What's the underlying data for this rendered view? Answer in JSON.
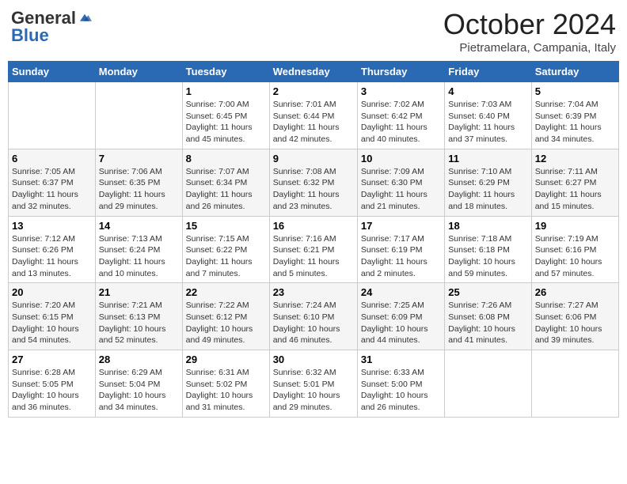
{
  "header": {
    "logo_general": "General",
    "logo_blue": "Blue",
    "month_title": "October 2024",
    "location": "Pietramelara, Campania, Italy"
  },
  "weekdays": [
    "Sunday",
    "Monday",
    "Tuesday",
    "Wednesday",
    "Thursday",
    "Friday",
    "Saturday"
  ],
  "weeks": [
    [
      {
        "day": "",
        "info": ""
      },
      {
        "day": "",
        "info": ""
      },
      {
        "day": "1",
        "info": "Sunrise: 7:00 AM\nSunset: 6:45 PM\nDaylight: 11 hours and 45 minutes."
      },
      {
        "day": "2",
        "info": "Sunrise: 7:01 AM\nSunset: 6:44 PM\nDaylight: 11 hours and 42 minutes."
      },
      {
        "day": "3",
        "info": "Sunrise: 7:02 AM\nSunset: 6:42 PM\nDaylight: 11 hours and 40 minutes."
      },
      {
        "day": "4",
        "info": "Sunrise: 7:03 AM\nSunset: 6:40 PM\nDaylight: 11 hours and 37 minutes."
      },
      {
        "day": "5",
        "info": "Sunrise: 7:04 AM\nSunset: 6:39 PM\nDaylight: 11 hours and 34 minutes."
      }
    ],
    [
      {
        "day": "6",
        "info": "Sunrise: 7:05 AM\nSunset: 6:37 PM\nDaylight: 11 hours and 32 minutes."
      },
      {
        "day": "7",
        "info": "Sunrise: 7:06 AM\nSunset: 6:35 PM\nDaylight: 11 hours and 29 minutes."
      },
      {
        "day": "8",
        "info": "Sunrise: 7:07 AM\nSunset: 6:34 PM\nDaylight: 11 hours and 26 minutes."
      },
      {
        "day": "9",
        "info": "Sunrise: 7:08 AM\nSunset: 6:32 PM\nDaylight: 11 hours and 23 minutes."
      },
      {
        "day": "10",
        "info": "Sunrise: 7:09 AM\nSunset: 6:30 PM\nDaylight: 11 hours and 21 minutes."
      },
      {
        "day": "11",
        "info": "Sunrise: 7:10 AM\nSunset: 6:29 PM\nDaylight: 11 hours and 18 minutes."
      },
      {
        "day": "12",
        "info": "Sunrise: 7:11 AM\nSunset: 6:27 PM\nDaylight: 11 hours and 15 minutes."
      }
    ],
    [
      {
        "day": "13",
        "info": "Sunrise: 7:12 AM\nSunset: 6:26 PM\nDaylight: 11 hours and 13 minutes."
      },
      {
        "day": "14",
        "info": "Sunrise: 7:13 AM\nSunset: 6:24 PM\nDaylight: 11 hours and 10 minutes."
      },
      {
        "day": "15",
        "info": "Sunrise: 7:15 AM\nSunset: 6:22 PM\nDaylight: 11 hours and 7 minutes."
      },
      {
        "day": "16",
        "info": "Sunrise: 7:16 AM\nSunset: 6:21 PM\nDaylight: 11 hours and 5 minutes."
      },
      {
        "day": "17",
        "info": "Sunrise: 7:17 AM\nSunset: 6:19 PM\nDaylight: 11 hours and 2 minutes."
      },
      {
        "day": "18",
        "info": "Sunrise: 7:18 AM\nSunset: 6:18 PM\nDaylight: 10 hours and 59 minutes."
      },
      {
        "day": "19",
        "info": "Sunrise: 7:19 AM\nSunset: 6:16 PM\nDaylight: 10 hours and 57 minutes."
      }
    ],
    [
      {
        "day": "20",
        "info": "Sunrise: 7:20 AM\nSunset: 6:15 PM\nDaylight: 10 hours and 54 minutes."
      },
      {
        "day": "21",
        "info": "Sunrise: 7:21 AM\nSunset: 6:13 PM\nDaylight: 10 hours and 52 minutes."
      },
      {
        "day": "22",
        "info": "Sunrise: 7:22 AM\nSunset: 6:12 PM\nDaylight: 10 hours and 49 minutes."
      },
      {
        "day": "23",
        "info": "Sunrise: 7:24 AM\nSunset: 6:10 PM\nDaylight: 10 hours and 46 minutes."
      },
      {
        "day": "24",
        "info": "Sunrise: 7:25 AM\nSunset: 6:09 PM\nDaylight: 10 hours and 44 minutes."
      },
      {
        "day": "25",
        "info": "Sunrise: 7:26 AM\nSunset: 6:08 PM\nDaylight: 10 hours and 41 minutes."
      },
      {
        "day": "26",
        "info": "Sunrise: 7:27 AM\nSunset: 6:06 PM\nDaylight: 10 hours and 39 minutes."
      }
    ],
    [
      {
        "day": "27",
        "info": "Sunrise: 6:28 AM\nSunset: 5:05 PM\nDaylight: 10 hours and 36 minutes."
      },
      {
        "day": "28",
        "info": "Sunrise: 6:29 AM\nSunset: 5:04 PM\nDaylight: 10 hours and 34 minutes."
      },
      {
        "day": "29",
        "info": "Sunrise: 6:31 AM\nSunset: 5:02 PM\nDaylight: 10 hours and 31 minutes."
      },
      {
        "day": "30",
        "info": "Sunrise: 6:32 AM\nSunset: 5:01 PM\nDaylight: 10 hours and 29 minutes."
      },
      {
        "day": "31",
        "info": "Sunrise: 6:33 AM\nSunset: 5:00 PM\nDaylight: 10 hours and 26 minutes."
      },
      {
        "day": "",
        "info": ""
      },
      {
        "day": "",
        "info": ""
      }
    ]
  ]
}
